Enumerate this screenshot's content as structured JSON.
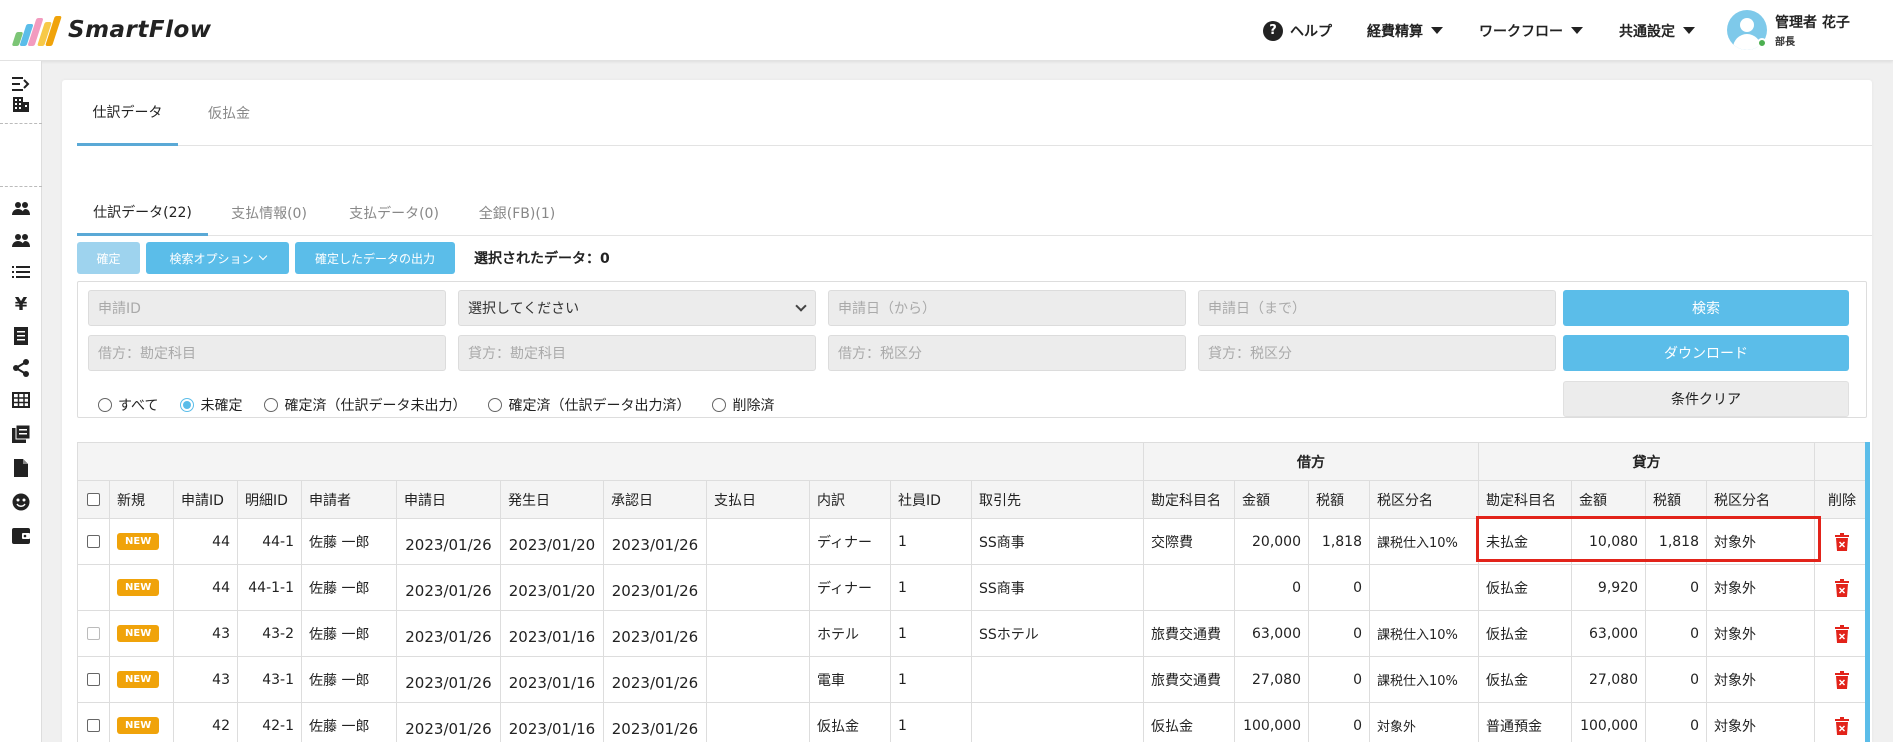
{
  "header": {
    "app_name": "SmartFlow",
    "help_label": "ヘルプ",
    "menu": [
      "経費精算",
      "ワークフロー",
      "共通設定"
    ],
    "user_name": "管理者 花子",
    "user_role": "部長"
  },
  "sidebar": {
    "icons": [
      "collapse-icon",
      "building-icon",
      "users-icon",
      "user-group-icon",
      "list-icon",
      "yen-icon",
      "document-icon",
      "share-icon",
      "table-icon",
      "journal-icon",
      "file-icon",
      "smile-icon",
      "wallet-icon"
    ]
  },
  "tabs_top": [
    "仕訳データ",
    "仮払金"
  ],
  "tabs_sub": [
    "仕訳データ(22)",
    "支払情報(0)",
    "支払データ(0)",
    "全銀(FB)(1)"
  ],
  "toolbar": {
    "confirm_label": "確定",
    "search_options_label": "検索オプション",
    "export_label": "確定したデータの出力",
    "selected_label": "選択されたデータ：0"
  },
  "filters": {
    "application_id_placeholder": "申請ID",
    "select_value": "選択してください",
    "date_from_placeholder": "申請日（から）",
    "date_to_placeholder": "申請日（まで）",
    "debit_account_placeholder": "借方：勘定科目",
    "credit_account_placeholder": "貸方：勘定科目",
    "debit_tax_placeholder": "借方：税区分",
    "credit_tax_placeholder": "貸方：税区分",
    "search_label": "検索",
    "download_label": "ダウンロード",
    "clear_label": "条件クリア",
    "radios": [
      "すべて",
      "未確定",
      "確定済（仕訳データ未出力）",
      "確定済（仕訳データ出力済）",
      "削除済"
    ],
    "radio_selected": "未確定"
  },
  "table": {
    "group_debit": "借方",
    "group_credit": "貸方",
    "columns": [
      "新規",
      "申請ID",
      "明細ID",
      "申請者",
      "申請日",
      "発生日",
      "承認日",
      "支払日",
      "内訳",
      "社員ID",
      "取引先",
      "勘定科目名",
      "金額",
      "税額",
      "税区分名",
      "勘定科目名",
      "金額",
      "税額",
      "税区分名",
      "削除"
    ],
    "new_badge": "NEW",
    "rows": [
      {
        "app_id": "44",
        "detail_id": "44-1",
        "applicant": "佐藤 一郎",
        "applied": "2023/01/26",
        "occurred": "2023/01/20",
        "approved": "2023/01/26",
        "paid": "",
        "breakdown": "ディナー",
        "emp_id": "1",
        "partner": "SS商事",
        "d_account": "交際費",
        "d_amount": "20,000",
        "d_tax": "1,818",
        "d_tax_type": "課税仕入10%",
        "c_account": "未払金",
        "c_amount": "10,080",
        "c_tax": "1,818",
        "c_tax_type": "対象外"
      },
      {
        "app_id": "44",
        "detail_id": "44-1-1",
        "applicant": "佐藤 一郎",
        "applied": "2023/01/26",
        "occurred": "2023/01/20",
        "approved": "2023/01/26",
        "paid": "",
        "breakdown": "ディナー",
        "emp_id": "1",
        "partner": "SS商事",
        "d_account": "",
        "d_amount": "0",
        "d_tax": "0",
        "d_tax_type": "",
        "c_account": "仮払金",
        "c_amount": "9,920",
        "c_tax": "0",
        "c_tax_type": "対象外"
      },
      {
        "app_id": "43",
        "detail_id": "43-2",
        "applicant": "佐藤 一郎",
        "applied": "2023/01/26",
        "occurred": "2023/01/16",
        "approved": "2023/01/26",
        "paid": "",
        "breakdown": "ホテル",
        "emp_id": "1",
        "partner": "SSホテル",
        "d_account": "旅費交通費",
        "d_amount": "63,000",
        "d_tax": "0",
        "d_tax_type": "課税仕入10%",
        "c_account": "仮払金",
        "c_amount": "63,000",
        "c_tax": "0",
        "c_tax_type": "対象外"
      },
      {
        "app_id": "43",
        "detail_id": "43-1",
        "applicant": "佐藤 一郎",
        "applied": "2023/01/26",
        "occurred": "2023/01/16",
        "approved": "2023/01/26",
        "paid": "",
        "breakdown": "電車",
        "emp_id": "1",
        "partner": "",
        "d_account": "旅費交通費",
        "d_amount": "27,080",
        "d_tax": "0",
        "d_tax_type": "課税仕入10%",
        "c_account": "仮払金",
        "c_amount": "27,080",
        "c_tax": "0",
        "c_tax_type": "対象外"
      },
      {
        "app_id": "42",
        "detail_id": "42-1",
        "applicant": "佐藤 一郎",
        "applied": "2023/01/26",
        "occurred": "2023/01/16",
        "approved": "2023/01/26",
        "paid": "",
        "breakdown": "仮払金",
        "emp_id": "1",
        "partner": "",
        "d_account": "仮払金",
        "d_amount": "100,000",
        "d_tax": "0",
        "d_tax_type": "対象外",
        "c_account": "普通預金",
        "c_amount": "100,000",
        "c_tax": "0",
        "c_tax_type": "対象外"
      }
    ]
  },
  "colors": {
    "accent": "#5bbde9",
    "badge": "#f0a30a",
    "delete": "#e2231a"
  }
}
